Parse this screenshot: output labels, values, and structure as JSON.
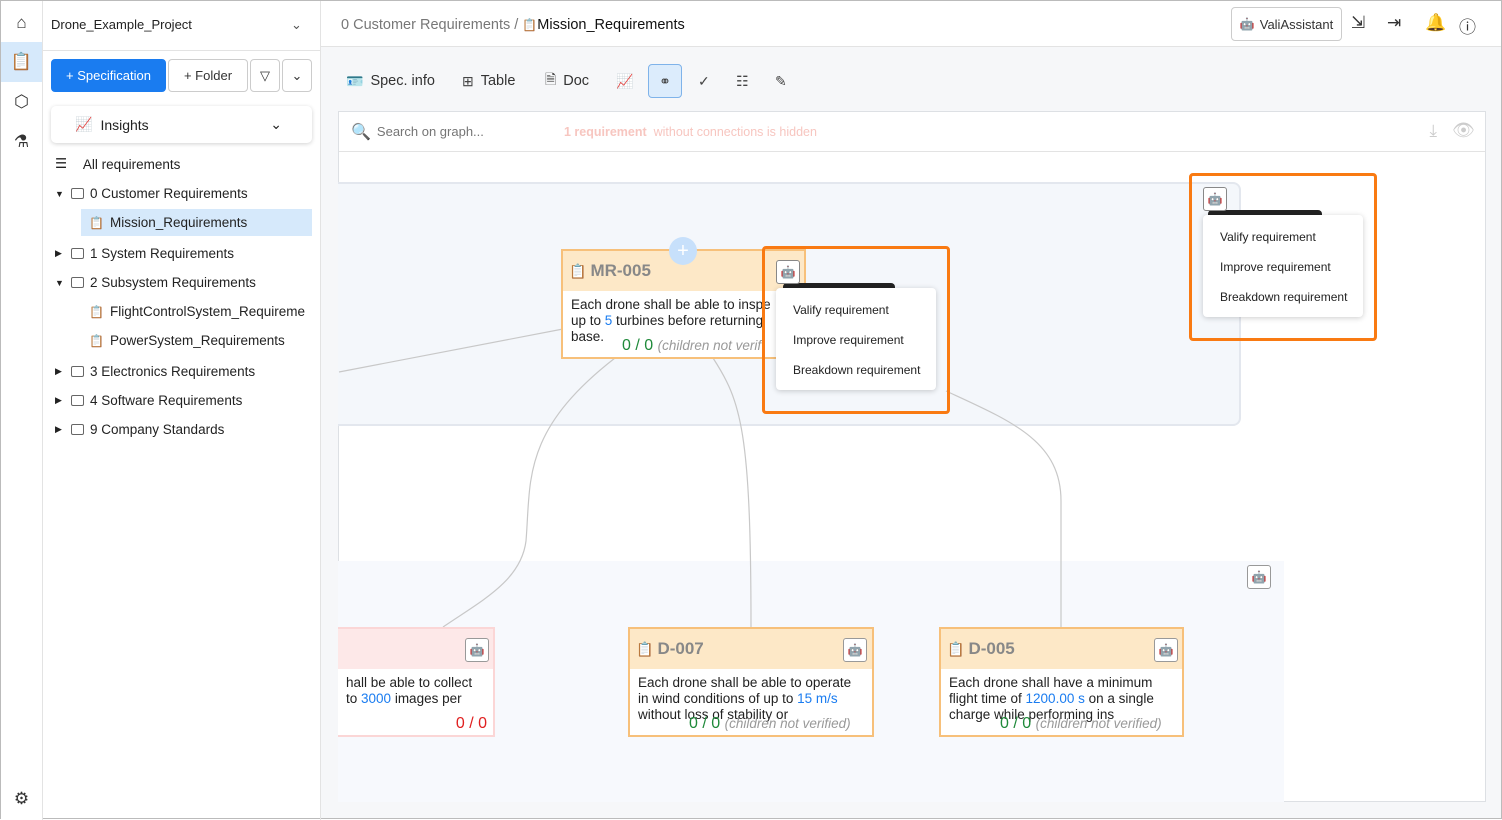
{
  "rail": {
    "icons": [
      "home-icon",
      "specification-icon",
      "components-icon",
      "test-icon",
      "settings-icon"
    ]
  },
  "sidebar": {
    "project": "Drone_Example_Project",
    "add_spec": "+ Specification",
    "add_folder": "+ Folder",
    "insights": "Insights",
    "all": "All requirements",
    "tree": [
      {
        "label": "0 Customer Requirements",
        "type": "folder",
        "expanded": true
      },
      {
        "label": "Mission_Requirements",
        "type": "spec",
        "selected": true
      },
      {
        "label": "1 System Requirements",
        "type": "folder"
      },
      {
        "label": "2 Subsystem Requirements",
        "type": "folder",
        "expanded": true
      },
      {
        "label": "FlightControlSystem_Requireme",
        "type": "spec"
      },
      {
        "label": "PowerSystem_Requirements",
        "type": "spec"
      },
      {
        "label": "3 Electronics Requirements",
        "type": "folder"
      },
      {
        "label": "4 Software Requirements",
        "type": "folder"
      },
      {
        "label": "9 Company Standards",
        "type": "folder"
      }
    ]
  },
  "header": {
    "crumb_parent": "0 Customer Requirements",
    "crumb_sep": "/",
    "crumb_current": "Mission_Requirements",
    "assistant": "ValiAssistant"
  },
  "toolbar": {
    "spec_info": "Spec. info",
    "table": "Table",
    "doc": "Doc"
  },
  "graph": {
    "search_placeholder": "Search on graph...",
    "hint_count": "1 requirement",
    "hint_text": "without connections is hidden",
    "nodes": {
      "mr005": {
        "id": "MR-005",
        "text_a": "Each drone shall be able to inspe",
        "text_b": "up to ",
        "num": "5",
        "text_c": " turbines before returning",
        "text_d": "base.",
        "status": "0 / 0",
        "note": "(children not verif"
      },
      "left": {
        "text_a": "hall be able to collect",
        "text_b": "to ",
        "num": "3000",
        "text_c": " images per",
        "status": "0 / 0"
      },
      "d007": {
        "id": "D-007",
        "text_a": "Each drone shall be able to operate",
        "text_b": "in wind conditions of up to ",
        "num": "15",
        "unit": " m/s",
        "text_c": "without loss of stability or",
        "status": "0 / 0",
        "note": "(children not verified)"
      },
      "d005": {
        "id": "D-005",
        "text_a": "Each drone shall have a minimum",
        "text_b": "flight time of ",
        "num": "1200.00",
        "unit": " s",
        "text_c": " on a single",
        "text_d": "charge while performing ins",
        "status": "0 / 0",
        "note": "(children not verified)"
      }
    },
    "menu": [
      "Valify requirement",
      "Improve requirement",
      "Breakdown requirement"
    ]
  },
  "colors": {
    "accent": "#1a7cf0",
    "highlight": "#f97a12",
    "node_header": "#fde8c7"
  }
}
